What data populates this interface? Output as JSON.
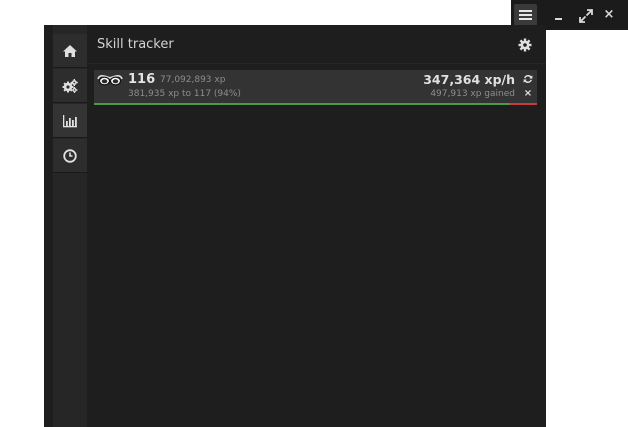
{
  "window_controls": {
    "menu_icon": "hamburger-icon",
    "minimize_icon": "minimize-icon",
    "maximize_icon": "expand-icon",
    "close_label": "×"
  },
  "sidebar": {
    "items": [
      {
        "icon": "home-icon"
      },
      {
        "icon": "cogs-icon"
      },
      {
        "icon": "bar-chart-icon",
        "active": true
      },
      {
        "icon": "clock-icon"
      }
    ]
  },
  "header": {
    "title": "Skill tracker",
    "settings_icon": "gear-icon"
  },
  "skill": {
    "icon": "goggles-icon",
    "level": "116",
    "total_xp": "77,092,893 xp",
    "to_next": "381,935 xp to 117 (94%)",
    "rate": "347,364 xp/h",
    "gained": "497,913 xp gained",
    "progress": 0.94,
    "refresh_icon": "refresh-icon",
    "remove_label": "×"
  },
  "colors": {
    "progress_fill": "#4c9a44",
    "progress_remaining": "#c73b3b",
    "panel_bg": "#1e1e1e",
    "row_bg": "#333333"
  }
}
